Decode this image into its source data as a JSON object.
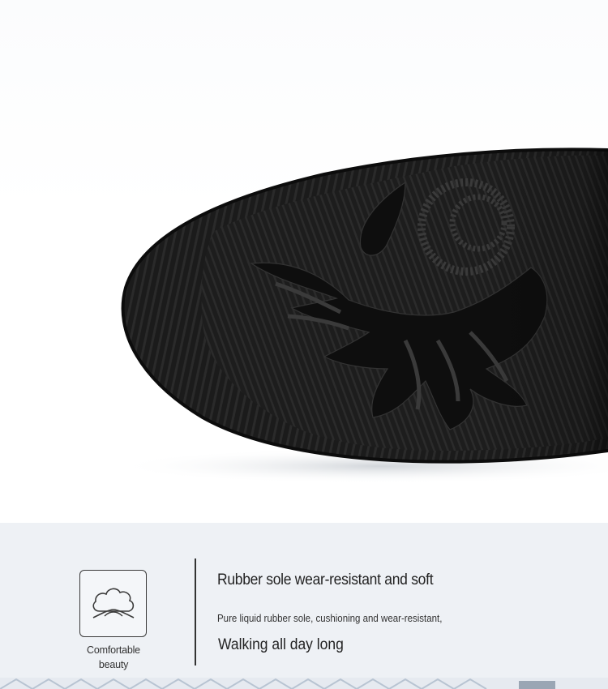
{
  "hero": {
    "subject": "shoe-sole-photo"
  },
  "feature": {
    "icon": "cloud-comfort-icon",
    "caption_line1": "Comfortable",
    "caption_line2": "beauty",
    "title": "Rubber sole wear-resistant and soft",
    "description": "Pure liquid rubber sole, cushioning and wear-resistant,",
    "tagline": "Walking all day long"
  },
  "colors": {
    "panel_bg": "#eef1f5",
    "sole": "#1a1a1a",
    "text": "#222222"
  }
}
